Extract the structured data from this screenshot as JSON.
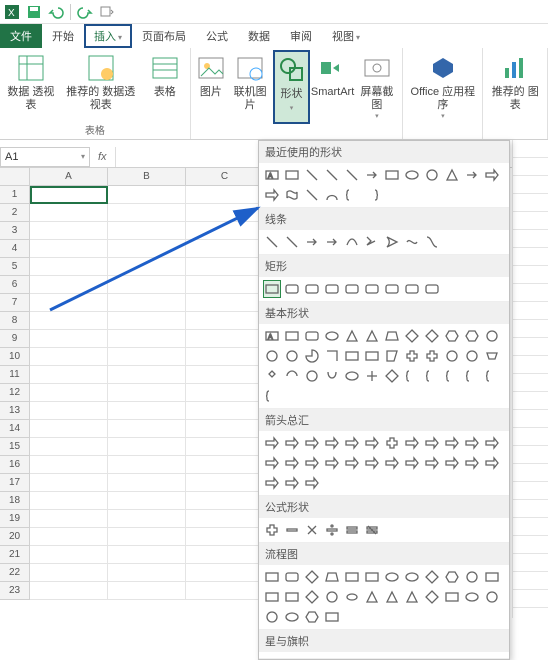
{
  "qat": {
    "items": [
      "save-icon",
      "undo-icon",
      "redo-icon",
      "touch-icon"
    ]
  },
  "tabs": {
    "file": "文件",
    "home": "开始",
    "insert": "插入",
    "layout": "页面布局",
    "formulas": "公式",
    "data": "数据",
    "review": "审阅",
    "view": "视图"
  },
  "ribbon": {
    "tables": {
      "label": "表格",
      "pivot": "数据\n透视表",
      "recpivot": "推荐的\n数据透视表",
      "table": "表格"
    },
    "illus": {
      "pic": "图片",
      "online": "联机图片",
      "shapes": "形状",
      "smartart": "SmartArt",
      "screenshot": "屏幕截图"
    },
    "addins": {
      "office": "Office\n应用程序"
    },
    "charts": {
      "rec": "推荐的\n图表"
    }
  },
  "namebox": "A1",
  "fx": "fx",
  "cols": [
    "A",
    "B",
    "C"
  ],
  "rows": [
    "1",
    "2",
    "3",
    "4",
    "5",
    "6",
    "7",
    "8",
    "9",
    "10",
    "11",
    "12",
    "13",
    "14",
    "15",
    "16",
    "17",
    "18",
    "19",
    "20",
    "21",
    "22",
    "23"
  ],
  "shape_sections": {
    "recent": "最近使用的形状",
    "lines": "线条",
    "rects": "矩形",
    "basic": "基本形状",
    "arrows": "箭头总汇",
    "equation": "公式形状",
    "flowchart": "流程图",
    "stars": "星与旗帜"
  },
  "chart_data": null
}
